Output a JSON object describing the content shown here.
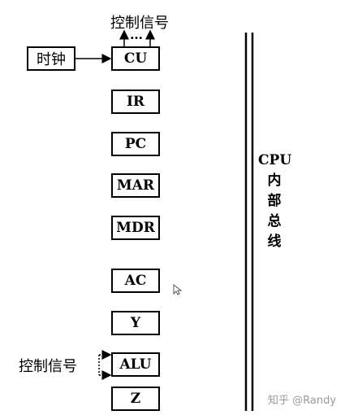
{
  "top_control_label": "控制信号",
  "ellipsis": "…",
  "clock_label": "时钟",
  "registers": {
    "cu": "CU",
    "ir": "IR",
    "pc": "PC",
    "mar": "MAR",
    "mdr": "MDR",
    "ac": "AC",
    "y": "Y",
    "alu": "ALU",
    "z": "Z"
  },
  "alu_control_label": "控制信号",
  "bus_label": [
    "CPU",
    "内",
    "部",
    "总",
    "线"
  ],
  "watermark": "知乎 @Randy"
}
